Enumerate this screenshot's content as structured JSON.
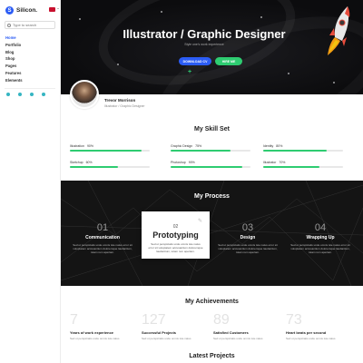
{
  "sidebar": {
    "logo": {
      "mark": "S",
      "text": "Silicon."
    },
    "search_placeholder": "Type to search",
    "nav": [
      "Home",
      "Portfolio",
      "Blog",
      "Shop",
      "Pages",
      "Features",
      "Elements"
    ]
  },
  "hero": {
    "title": "Illustrator / Graphic Designer",
    "subtitle": "Style one's work experience",
    "download_label": "DOWNLOAD CV",
    "hire_label": "HIRE ME",
    "plus": "+"
  },
  "profile": {
    "name": "Trevor Morrison",
    "role": "Illustrator / Graphic Designer"
  },
  "skills": {
    "title": "My Skill Set",
    "items": [
      {
        "label": "Illustration",
        "value": 90,
        "pct_text": "90%"
      },
      {
        "label": "Graphic Design",
        "value": 75,
        "pct_text": "75%"
      },
      {
        "label": "Identity",
        "value": 80,
        "pct_text": "80%"
      },
      {
        "label": "Sketchup",
        "value": 60,
        "pct_text": "60%"
      },
      {
        "label": "Photoshop",
        "value": 90,
        "pct_text": "90%"
      },
      {
        "label": "Illustrator",
        "value": 70,
        "pct_text": "70%"
      }
    ]
  },
  "process": {
    "title": "My Process",
    "steps": [
      {
        "num": "01",
        "label": "Communication",
        "desc": "Sed ut perspiciatis unde omnis iste natus error sit voluptatem accusantium doloremque laudantium, totam rem aperiam."
      },
      {
        "num": "02",
        "label": "Prototyping",
        "desc": "Sed ut perspiciatis unde omnis iste natus error sit voluptatem accusantium doloremque laudantium, totam rem aperiam."
      },
      {
        "num": "03",
        "label": "Design",
        "desc": "Sed ut perspiciatis unde omnis iste natus error sit voluptatem accusantium doloremque laudantium, totam rem aperiam."
      },
      {
        "num": "04",
        "label": "Wrapping Up",
        "desc": "Sed ut perspiciatis unde omnis iste natus error sit voluptatem accusantium doloremque laudantium, totam rem aperiam."
      }
    ]
  },
  "achievements": {
    "title": "My Achievements",
    "items": [
      {
        "num": "7",
        "label": "Years of work experience",
        "desc": "Sed ut perspiciatis unde omnis iste natus"
      },
      {
        "num": "127",
        "label": "Successful Projects",
        "desc": "Sed ut perspiciatis unde omnis iste natus"
      },
      {
        "num": "89",
        "label": "Satisfied Customers",
        "desc": "Sed ut perspiciatis unde omnis iste natus"
      },
      {
        "num": "73",
        "label": "Heart beats per second",
        "desc": "Sed ut perspiciatis unde omnis iste natus"
      }
    ]
  },
  "latest": {
    "title": "Latest Projects"
  },
  "colors": {
    "accent": "#2b5cf5",
    "success": "#2ecc71",
    "dark": "#141414"
  }
}
